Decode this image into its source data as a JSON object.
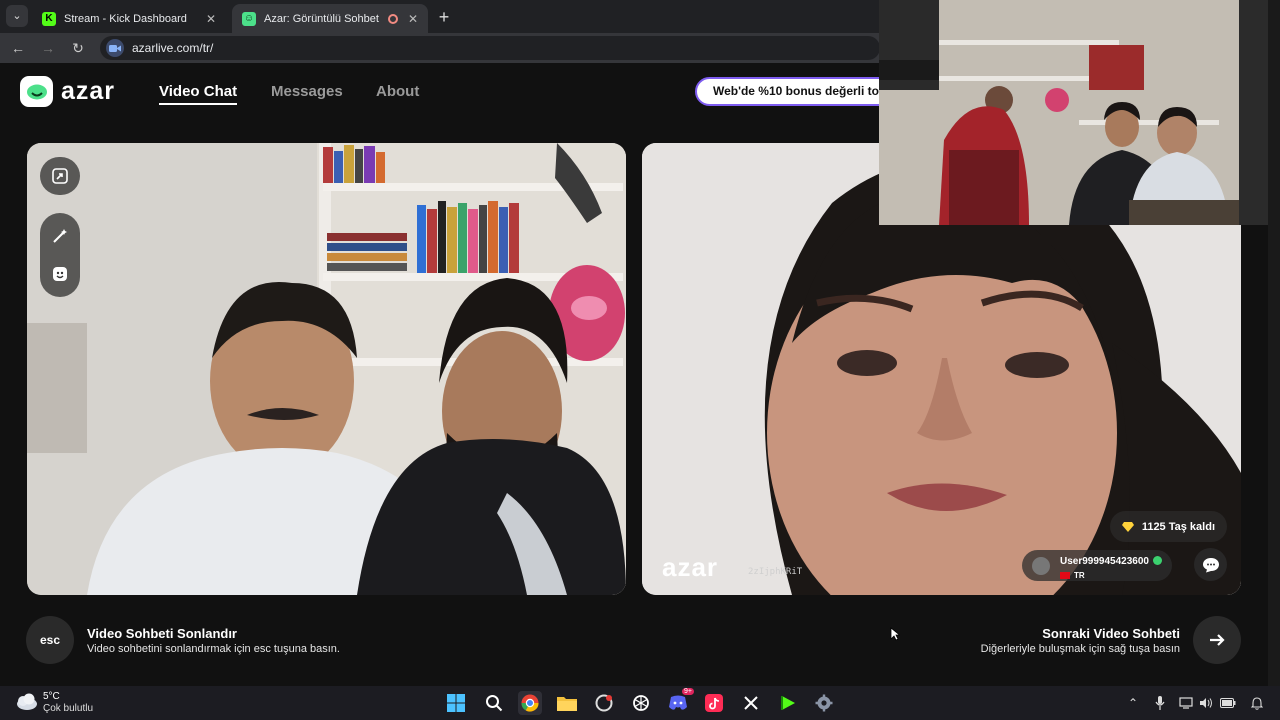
{
  "browser": {
    "tabs": [
      {
        "title": "Stream - Kick Dashboard",
        "favicon": "kick-icon",
        "active": false
      },
      {
        "title": "Azar: Görüntülü Sohbet & Y",
        "favicon": "azar-icon",
        "active": true
      }
    ],
    "url": "azarlive.com/tr/"
  },
  "header": {
    "logo_text": "azar",
    "nav": [
      {
        "label": "Video Chat",
        "active": true
      },
      {
        "label": "Messages",
        "active": false
      },
      {
        "label": "About",
        "active": false
      }
    ],
    "promo_text": "Web'de %10 bonus değerli to"
  },
  "remote_video": {
    "watermark": "azar",
    "code": "2zIjphKRiT",
    "gems_label": "1125 Taş kaldı",
    "username": "User999945423600",
    "country": "TR"
  },
  "footer": {
    "end": {
      "key": "esc",
      "title": "Video Sohbeti Sonlandır",
      "subtitle": "Video sohbetini sonlandırmak için esc tuşuna basın."
    },
    "next": {
      "title": "Sonraki Video Sohbeti",
      "subtitle": "Diğerleriyle buluşmak için sağ tuşa basın"
    }
  },
  "taskbar": {
    "weather_temp": "5°C",
    "weather_desc": "Çok bulutlu",
    "apps": [
      "start-icon",
      "search-icon",
      "chrome-icon",
      "file-explorer-icon",
      "app-icon",
      "chatgpt-icon",
      "discord-icon",
      "tiktok-icon",
      "x-icon",
      "kick-icon",
      "settings-icon"
    ],
    "discord_badge": "9+"
  },
  "colors": {
    "accent_green": "#4ce08a",
    "promo_border": "#7e5cf0",
    "kick_green": "#53fc18"
  }
}
